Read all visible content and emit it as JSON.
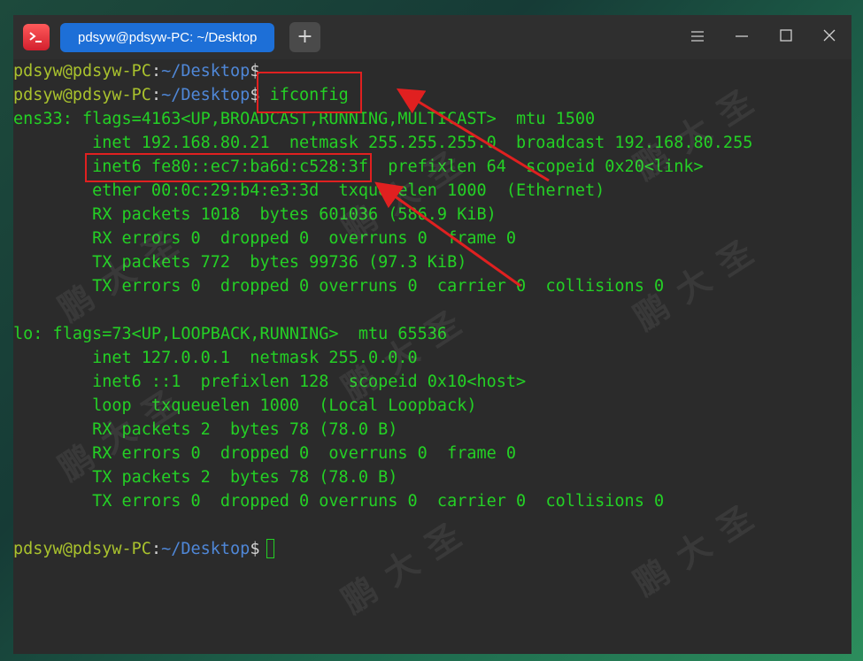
{
  "window": {
    "tab_title": "pdsyw@pdsyw-PC: ~/Desktop",
    "new_tab": "+",
    "menu_icon": "hamburger-menu-icon",
    "minimize_icon": "minimize-icon",
    "maximize_icon": "maximize-icon",
    "close_icon": "close-icon"
  },
  "prompt": {
    "user": "pdsyw@pdsyw-PC",
    "sep": ":",
    "path": "~/Desktop",
    "symbol": "$"
  },
  "prompt_lines": [
    {
      "command": ""
    },
    {
      "command": " ifconfig"
    },
    {
      "command": " "
    }
  ],
  "output": [
    "ens33: flags=4163<UP,BROADCAST,RUNNING,MULTICAST>  mtu 1500",
    "        inet 192.168.80.21  netmask 255.255.255.0  broadcast 192.168.80.255",
    "        inet6 fe80::ec7:ba6d:c528:3f  prefixlen 64  scopeid 0x20<link>",
    "        ether 00:0c:29:b4:e3:3d  txqueuelen 1000  (Ethernet)",
    "        RX packets 1018  bytes 601036 (586.9 KiB)",
    "        RX errors 0  dropped 0  overruns 0  frame 0",
    "        TX packets 772  bytes 99736 (97.3 KiB)",
    "        TX errors 0  dropped 0 overruns 0  carrier 0  collisions 0",
    "",
    "lo: flags=73<UP,LOOPBACK,RUNNING>  mtu 65536",
    "        inet 127.0.0.1  netmask 255.0.0.0",
    "        inet6 ::1  prefixlen 128  scopeid 0x10<host>",
    "        loop  txqueuelen 1000  (Local Loopback)",
    "        RX packets 2  bytes 78 (78.0 B)",
    "        RX errors 0  dropped 0  overruns 0  frame 0",
    "        TX packets 2  bytes 78 (78.0 B)",
    "        TX errors 0  dropped 0 overruns 0  carrier 0  collisions 0"
  ],
  "watermark": "鹏大圣",
  "colors": {
    "terminal_bg": "#2b2b2b",
    "text_green": "#24d025",
    "prompt_user": "#a9c22d",
    "prompt_path": "#4f87d7",
    "tab_accent": "#1d6fd7",
    "annotation_red": "#e02020"
  }
}
